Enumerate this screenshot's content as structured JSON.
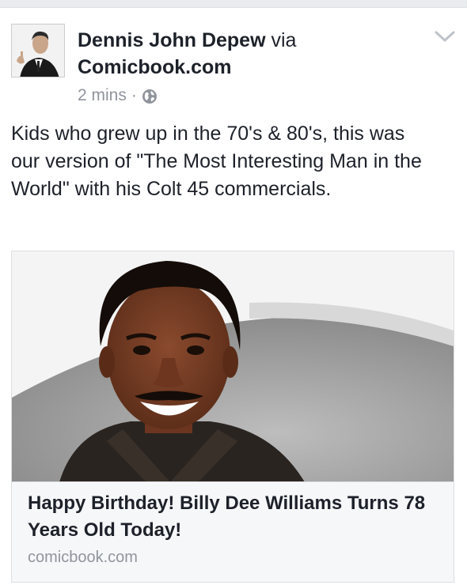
{
  "post": {
    "author": "Dennis John Depew",
    "via_label": "via",
    "source": "Comicbook.com",
    "time": "2 mins",
    "separator": "·",
    "text": "Kids who grew up in the 70's & 80's, this was our version of \"The Most Interesting Man in the World\" with his Colt 45 commercials."
  },
  "link": {
    "title": "Happy Birthday! Billy Dee Williams Turns 78 Years Old Today!",
    "domain": "comicbook.com"
  },
  "icons": {
    "privacy": "globe-icon",
    "menu": "chevron-down-icon"
  },
  "colors": {
    "text": "#1d2129",
    "meta": "#90949c",
    "card_bg": "#f6f7f9"
  }
}
